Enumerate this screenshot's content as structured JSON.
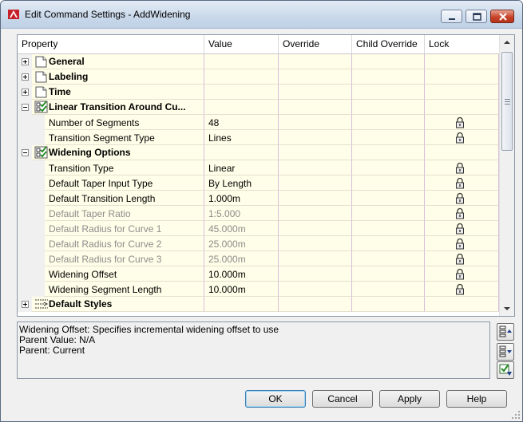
{
  "window": {
    "title": "Edit Command Settings - AddWidening"
  },
  "columns": [
    "Property",
    "Value",
    "Override",
    "Child Override",
    "Lock"
  ],
  "rows": [
    {
      "kind": "category",
      "expanded": false,
      "icon": "folder-icon",
      "label": "General"
    },
    {
      "kind": "category",
      "expanded": false,
      "icon": "folder-icon",
      "label": "Labeling"
    },
    {
      "kind": "category",
      "expanded": false,
      "icon": "folder-icon",
      "label": "Time"
    },
    {
      "kind": "category",
      "expanded": true,
      "icon": "checklist-icon",
      "label": "Linear Transition Around Cu..."
    },
    {
      "kind": "property",
      "label": "Number of Segments",
      "value": "48",
      "locked": true,
      "dim": false
    },
    {
      "kind": "property",
      "label": "Transition Segment Type",
      "value": "Lines",
      "locked": true,
      "dim": false
    },
    {
      "kind": "category",
      "expanded": true,
      "icon": "checklist-icon",
      "label": "Widening Options"
    },
    {
      "kind": "property",
      "label": "Transition Type",
      "value": "Linear",
      "locked": true,
      "dim": false
    },
    {
      "kind": "property",
      "label": "Default Taper Input Type",
      "value": "By Length",
      "locked": true,
      "dim": false
    },
    {
      "kind": "property",
      "label": "Default Transition Length",
      "value": "1.000m",
      "locked": true,
      "dim": false
    },
    {
      "kind": "property",
      "label": "Default Taper Ratio",
      "value": "1:5.000",
      "locked": true,
      "dim": true
    },
    {
      "kind": "property",
      "label": "Default Radius for Curve 1",
      "value": "45.000m",
      "locked": true,
      "dim": true
    },
    {
      "kind": "property",
      "label": "Default Radius for Curve 2",
      "value": "25.000m",
      "locked": true,
      "dim": true
    },
    {
      "kind": "property",
      "label": "Default Radius for Curve 3",
      "value": "25.000m",
      "locked": true,
      "dim": true
    },
    {
      "kind": "property",
      "label": "Widening Offset",
      "value": "10.000m",
      "locked": true,
      "dim": false
    },
    {
      "kind": "property",
      "label": "Widening Segment Length",
      "value": "10.000m",
      "locked": true,
      "dim": false
    },
    {
      "kind": "category",
      "expanded": false,
      "icon": "styles-icon",
      "label": "Default Styles"
    }
  ],
  "description": {
    "line1": "Widening Offset: Specifies incremental widening offset to use",
    "line2": "Parent Value: N/A",
    "line3": "Parent: Current"
  },
  "buttons": {
    "ok": "OK",
    "cancel": "Cancel",
    "apply": "Apply",
    "help": "Help"
  },
  "colors": {
    "cell_bg": "#fffee8",
    "grid_line": "#d9bedc",
    "dim_text": "#8c8c8c",
    "close_red": "#c7442a"
  }
}
